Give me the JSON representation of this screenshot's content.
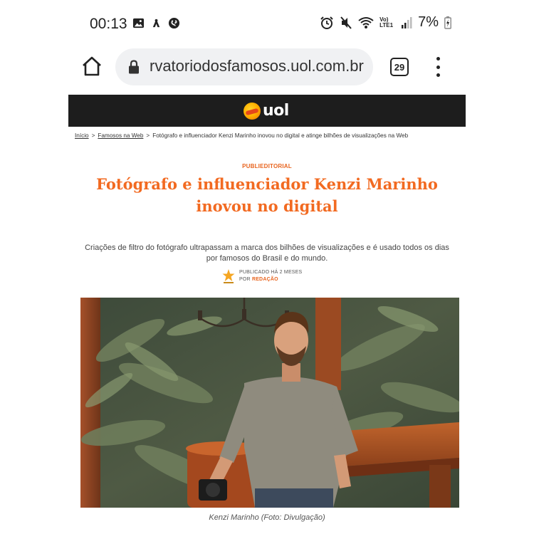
{
  "status_bar": {
    "time": "00:13",
    "left_icons": [
      "image-icon",
      "wifi-hotspot-icon",
      "shazam-icon"
    ],
    "right_icons": [
      "alarm-icon",
      "mute-icon",
      "wifi-icon",
      "volte-icon",
      "signal-icon"
    ],
    "volte_label": "Vo) LTE1",
    "battery": "7%"
  },
  "browser": {
    "url": "rvatoriodosfamosos.uol.com.br",
    "tab_count": "29"
  },
  "site": {
    "brand": "uol",
    "colors": {
      "header_bg": "#1d1d1d",
      "accent": "#f26a21"
    }
  },
  "breadcrumb": {
    "items": [
      "Início",
      "Famosos na Web"
    ],
    "current": "Fotógrafo e influenciador Kenzi Marinho inovou no digital e atinge bilhões de visualizações na Web",
    "separator": ">"
  },
  "article": {
    "kicker": "PUBLIEDITORIAL",
    "headline": "Fotógrafo e influenciador Kenzi Marinho inovou no digital",
    "subtitle": "Criações de filtro do fotógrafo ultrapassam a marca dos bilhões de visualizações e é usado todos os dias por famosos do Brasil e do mundo.",
    "published": "PUBLICADO HÁ 2 MESES",
    "by_label": "POR",
    "author": "REDAÇÃO",
    "photo_caption": "Kenzi Marinho (Foto: Divulgação)"
  }
}
